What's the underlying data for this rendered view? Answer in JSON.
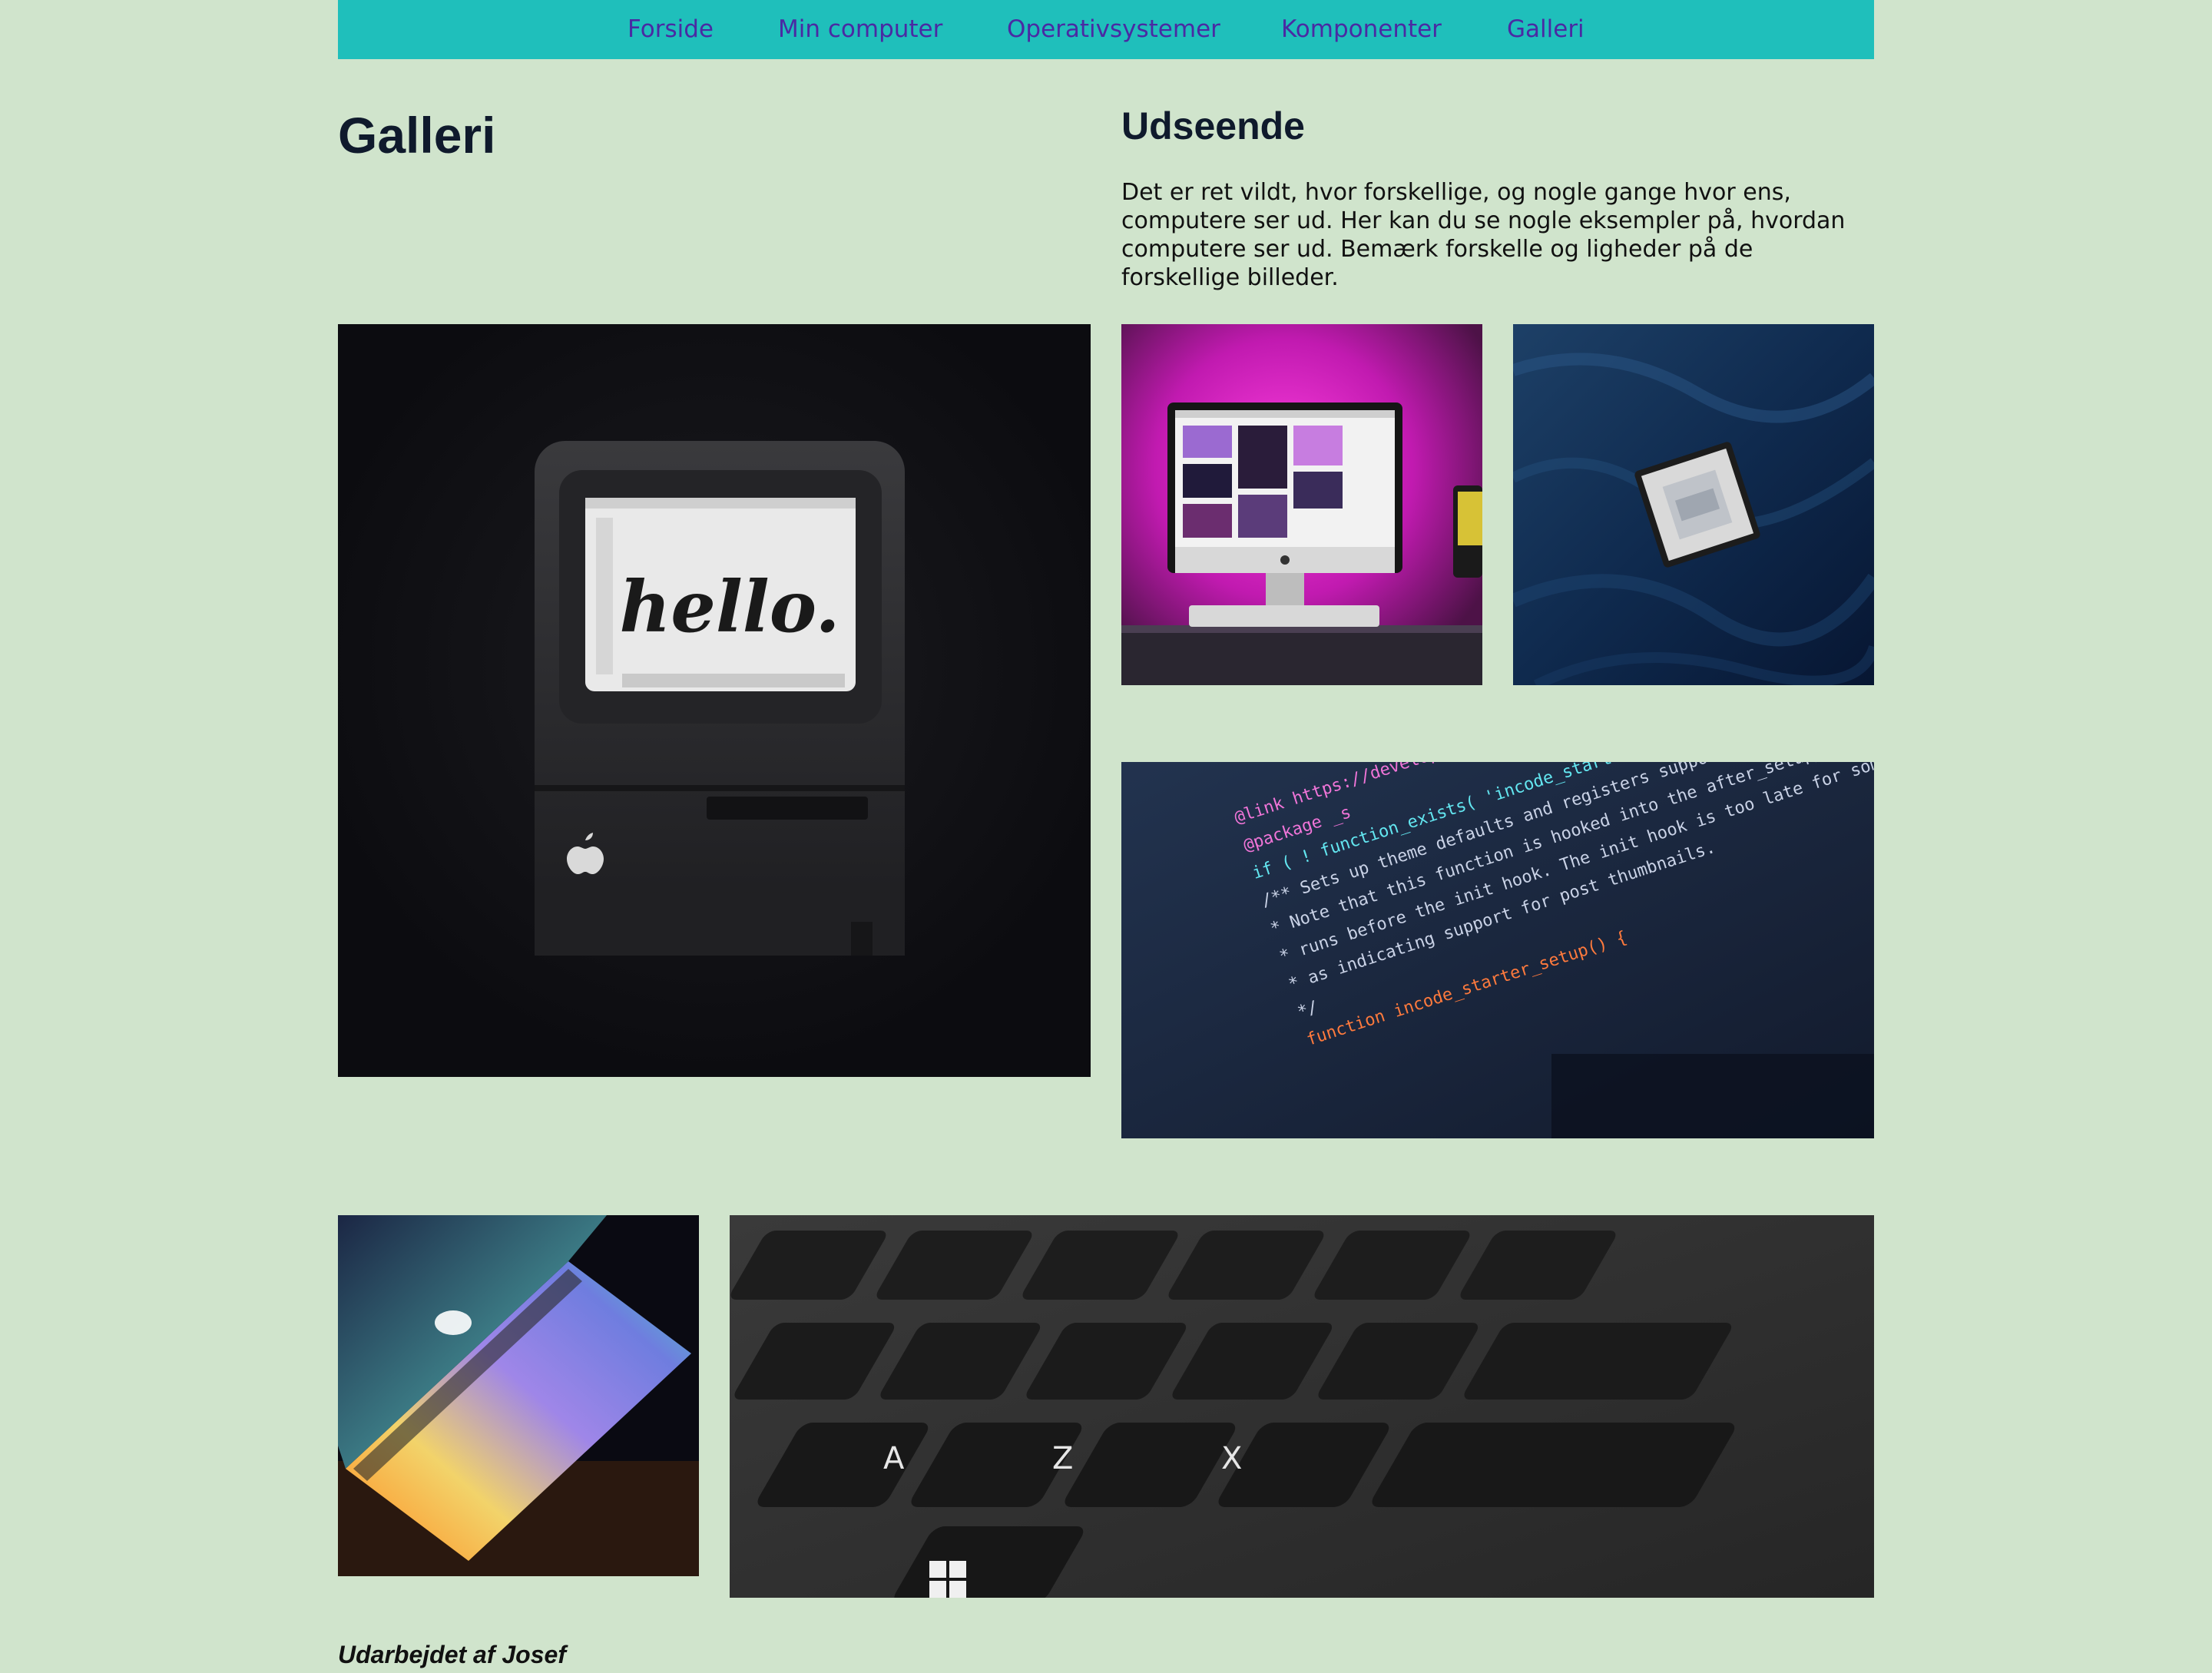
{
  "nav": {
    "items": [
      {
        "label": "Forside"
      },
      {
        "label": "Min computer"
      },
      {
        "label": "Operativsystemer"
      },
      {
        "label": "Komponenter"
      },
      {
        "label": "Galleri"
      }
    ]
  },
  "main": {
    "title": "Galleri",
    "section_title": "Udseende",
    "intro": "Det er ret vildt, hvor forskellige, og nogle gange hvor ens, computere ser ud. Her kan du se nogle eksempler på, hvordan computere ser ud. Bemærk forskelle og ligheder på de forskellige billeder."
  },
  "gallery": {
    "mac_screen_text": "hello.",
    "code_lines": [
      "@link https://developer",
      "@package _s",
      "if ( ! function_exists( 'incode_starter_setup' ) ) :",
      "/** Sets up theme defaults and registers support for various WordPress",
      " * Note that this function is hooked into the after_setup_theme hook",
      " * runs before the init hook. The init hook is too late for some",
      " * as indicating support for post thumbnails.",
      " */",
      "function incode_starter_setup() {"
    ],
    "key_letters": [
      "A",
      "Z",
      "X"
    ]
  },
  "footer": {
    "credit": "Udarbejdet af Josef"
  },
  "colors": {
    "background": "#d0e4cc",
    "nav_background": "#1fbfbb",
    "nav_link": "#4a2aa3",
    "heading": "#0f1a2c"
  }
}
